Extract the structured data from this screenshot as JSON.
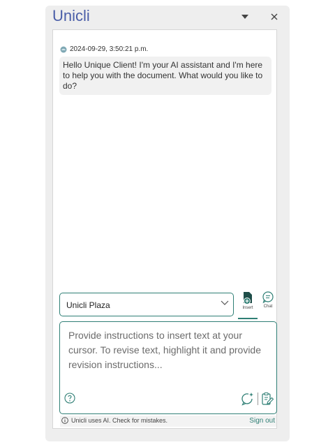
{
  "pane": {
    "title": "Unicli",
    "dropdown_icon": "caret-down-icon",
    "close_icon": "close-icon"
  },
  "conversation": {
    "messages": [
      {
        "timestamp": "2024-09-29, 3:50:21 p.m.",
        "avatar_icon": "assistant-avatar-icon",
        "text": "Hello Unique Client! I'm your AI assistant and I'm here to help you with the document. What would you like to do?"
      }
    ]
  },
  "controls": {
    "selected_option": "Unicli Plaza",
    "modes": {
      "insert_label": "Insert",
      "chat_label": "Chat",
      "active": "Insert"
    },
    "prompt_placeholder": "Provide instructions to insert text at your cursor. To revise text, highlight it and provide revision instructions..."
  },
  "footer": {
    "disclaimer": "Unicli uses AI. Check for mistakes.",
    "sign_out": "Sign out"
  },
  "colors": {
    "accent": "#2f7f75",
    "title": "#4a5ea8",
    "pane_bg": "#eeeeee"
  }
}
